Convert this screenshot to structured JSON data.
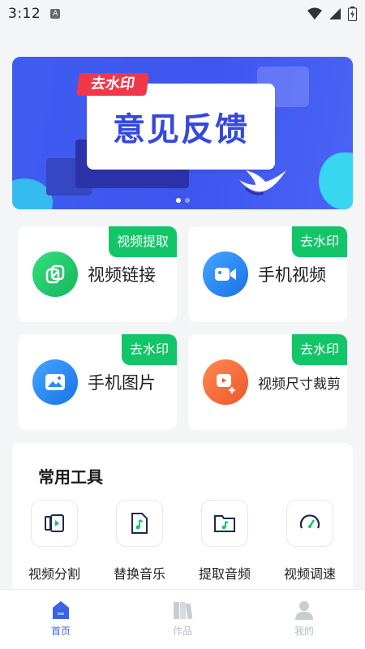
{
  "status": {
    "time": "3:12",
    "badge": "A"
  },
  "banner": {
    "tag": "去水印",
    "title": "意见反馈",
    "dots": 2,
    "active_dot": 0
  },
  "features": [
    {
      "label": "视频链接",
      "tag": "视频提取",
      "icon": "link-icon",
      "color": "#1fc46a"
    },
    {
      "label": "手机视频",
      "tag": "去水印",
      "icon": "video-camera-icon",
      "color": "#2a8cf0"
    },
    {
      "label": "手机图片",
      "tag": "去水印",
      "icon": "image-icon",
      "color": "#2a8cf0"
    },
    {
      "label": "视频尺寸裁剪",
      "tag": "去水印",
      "icon": "crop-video-icon",
      "color": "#f2693a"
    }
  ],
  "tools": {
    "title": "常用工具",
    "items": [
      {
        "label": "视频分割",
        "icon": "split-video-icon"
      },
      {
        "label": "替换音乐",
        "icon": "music-file-icon"
      },
      {
        "label": "提取音频",
        "icon": "music-folder-icon"
      },
      {
        "label": "视频调速",
        "icon": "speedometer-icon"
      }
    ]
  },
  "nav": {
    "items": [
      {
        "label": "首页",
        "icon": "home-icon",
        "active": true
      },
      {
        "label": "作品",
        "icon": "works-icon",
        "active": false
      },
      {
        "label": "我的",
        "icon": "profile-icon",
        "active": false
      }
    ]
  },
  "colors": {
    "accent": "#3a63e8",
    "tag_green": "#12c569",
    "banner_blue": "#3f5cf0"
  }
}
